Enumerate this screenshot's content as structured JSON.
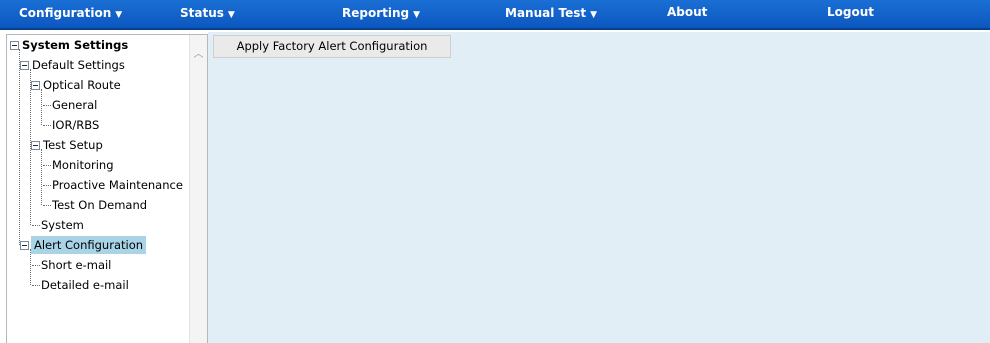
{
  "navbar": {
    "items": [
      {
        "label": "Configuration",
        "has_dropdown": true
      },
      {
        "label": "Status",
        "has_dropdown": true
      },
      {
        "label": "Reporting",
        "has_dropdown": true
      },
      {
        "label": "Manual Test",
        "has_dropdown": true
      },
      {
        "label": "About",
        "has_dropdown": false
      },
      {
        "label": "Logout",
        "has_dropdown": false
      }
    ],
    "dropdown_glyph": "▼"
  },
  "tree": {
    "root": "System Settings",
    "default_settings": "Default Settings",
    "optical_route": "Optical Route",
    "general": "General",
    "ior_rbs": "IOR/RBS",
    "test_setup": "Test Setup",
    "monitoring": "Monitoring",
    "proactive_maintenance": "Proactive Maintenance",
    "test_on_demand": "Test On Demand",
    "system": "System",
    "alert_configuration": "Alert Configuration",
    "short_email": "Short e-mail",
    "detailed_email": "Detailed e-mail",
    "selected": "Alert Configuration"
  },
  "content": {
    "apply_button_label": "Apply Factory Alert Configuration"
  },
  "colors": {
    "navbar": "#0b57c0",
    "content_bg": "#e2eef5",
    "selection": "#a9d4e7"
  }
}
